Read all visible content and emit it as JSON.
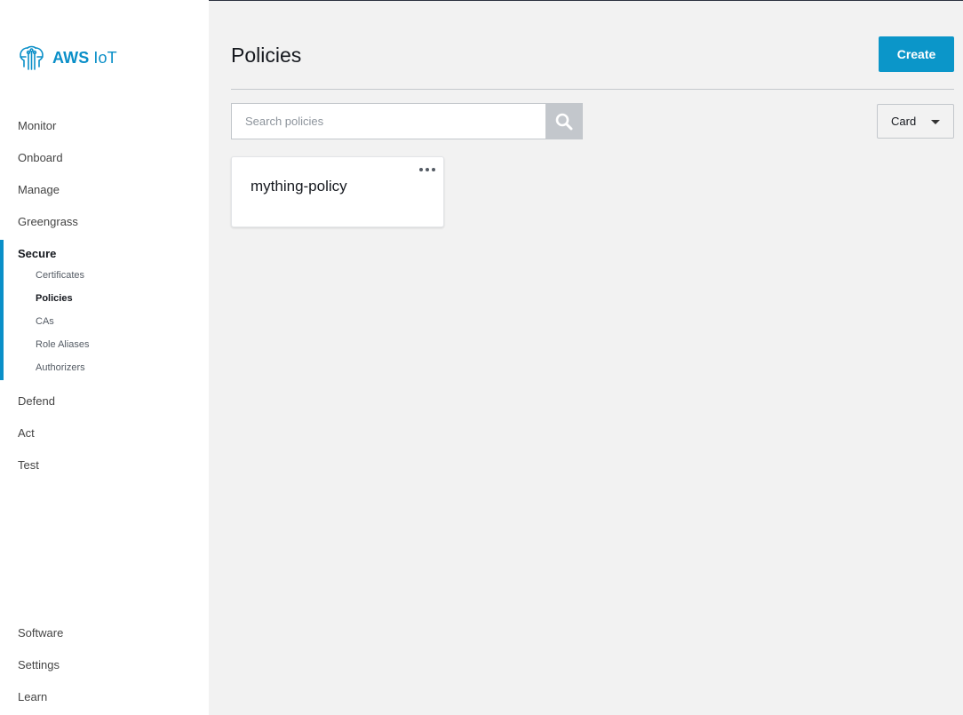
{
  "app": {
    "name_bold": "AWS",
    "name_rest": " IoT",
    "brand_color": "#0a8fc8"
  },
  "sidebar": {
    "items": [
      {
        "label": "Monitor"
      },
      {
        "label": "Onboard"
      },
      {
        "label": "Manage"
      },
      {
        "label": "Greengrass"
      },
      {
        "label": "Secure",
        "active": true
      },
      {
        "label": "Defend"
      },
      {
        "label": "Act"
      },
      {
        "label": "Test"
      }
    ],
    "secure_subitems": [
      {
        "label": "Certificates"
      },
      {
        "label": "Policies",
        "active": true
      },
      {
        "label": "CAs"
      },
      {
        "label": "Role Aliases"
      },
      {
        "label": "Authorizers"
      }
    ],
    "bottom_items": [
      {
        "label": "Software"
      },
      {
        "label": "Settings"
      },
      {
        "label": "Learn"
      }
    ]
  },
  "main": {
    "title": "Policies",
    "create_label": "Create",
    "search_placeholder": "Search policies",
    "search_value": "",
    "view_selected": "Card",
    "cards": [
      {
        "name": "mything-policy"
      }
    ]
  }
}
